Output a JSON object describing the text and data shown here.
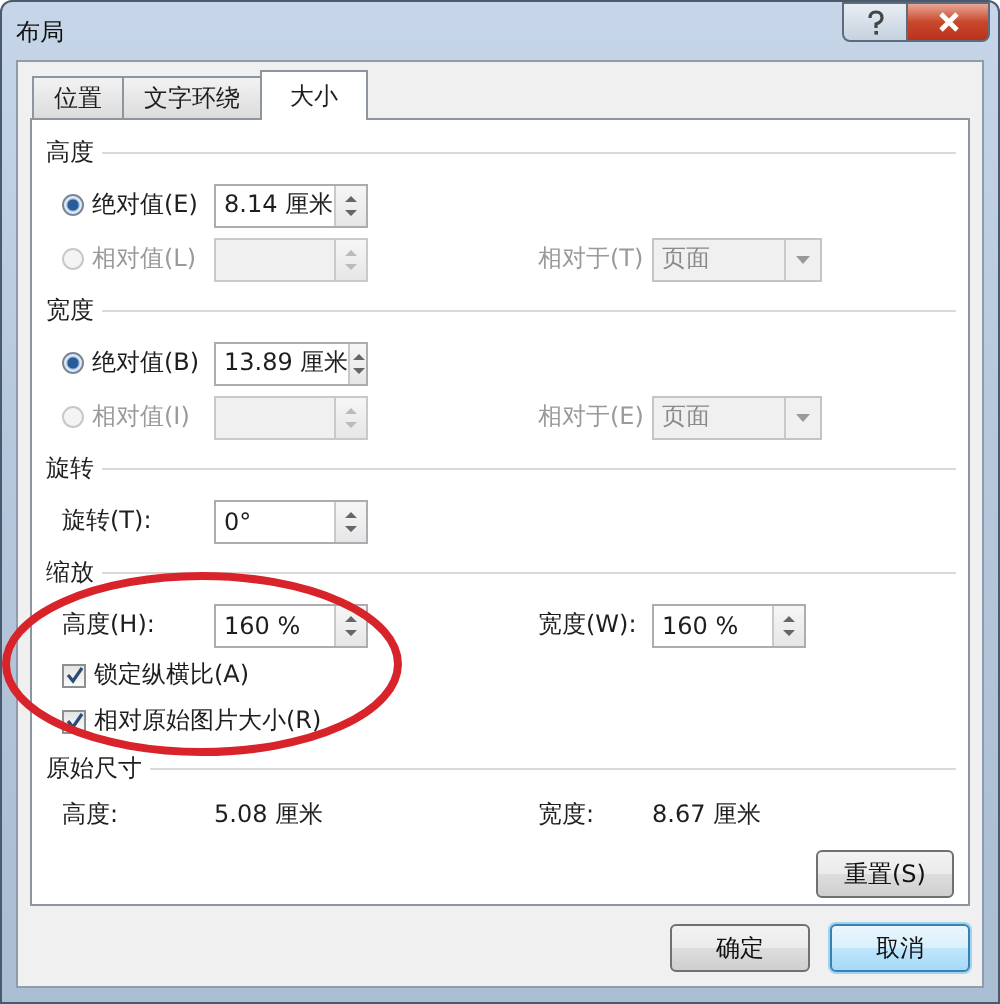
{
  "window": {
    "title": "布局"
  },
  "tabs": [
    {
      "label": "位置",
      "selected": false
    },
    {
      "label": "文字环绕",
      "selected": false
    },
    {
      "label": "大小",
      "selected": true
    }
  ],
  "sections": [
    {
      "title": "高度",
      "rows": [
        {
          "kind": "radio",
          "label": "绝对值(E)",
          "selected": true,
          "disabled": false,
          "value": "8.14 厘米"
        },
        {
          "kind": "radio",
          "label": "相对值(L)",
          "selected": false,
          "disabled": true,
          "relative_label": "相对于(T)",
          "relative_value": "页面"
        }
      ]
    },
    {
      "title": "宽度",
      "rows": [
        {
          "kind": "radio",
          "label": "绝对值(B)",
          "selected": true,
          "disabled": false,
          "value": "13.89 厘米"
        },
        {
          "kind": "radio",
          "label": "相对值(I)",
          "selected": false,
          "disabled": true,
          "relative_label": "相对于(E)",
          "relative_value": "页面"
        }
      ]
    },
    {
      "title": "旋转",
      "rows": [
        {
          "kind": "spin",
          "label": "旋转(T):",
          "value": "0°"
        }
      ]
    },
    {
      "title": "缩放",
      "rows": [
        {
          "kind": "spin",
          "label": "高度(H):",
          "value": "160 %",
          "right_label": "宽度(W):",
          "right_value": "160 %"
        },
        {
          "kind": "checkbox",
          "label": "锁定纵横比(A)",
          "checked": true
        },
        {
          "kind": "checkbox",
          "label": "相对原始图片大小(R)",
          "checked": true
        }
      ]
    },
    {
      "title": "原始尺寸",
      "rows": [
        {
          "kind": "info",
          "label": "高度:",
          "value": "5.08 厘米",
          "right_label": "宽度:",
          "right_value": "8.67 厘米"
        }
      ]
    }
  ],
  "reset_button": "重置(S)",
  "buttons": [
    {
      "label": "确定",
      "focused": false
    },
    {
      "label": "取消",
      "focused": true
    }
  ]
}
